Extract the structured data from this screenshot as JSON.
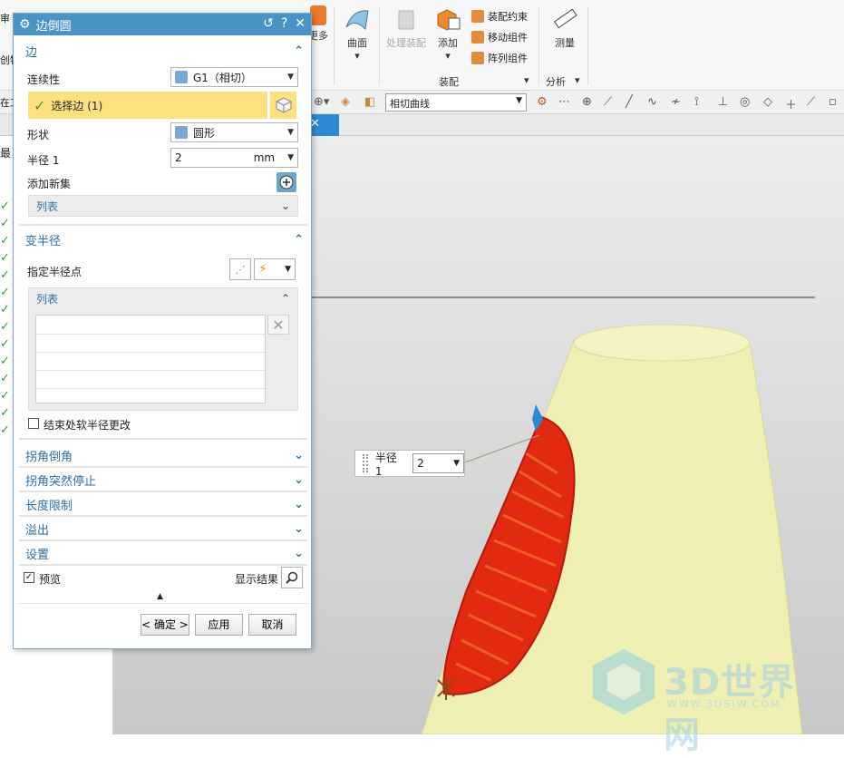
{
  "ribbon": {
    "left_labels": [
      "审",
      "创特"
    ],
    "more_label": "更多",
    "surface": {
      "label": "曲面"
    },
    "assembly_process": {
      "label": "处理装配"
    },
    "add": {
      "label": "添加"
    },
    "assembly_constraint": "装配约束",
    "move_component": "移动组件",
    "array_component": "阵列组件",
    "assembly_group": "装配",
    "measure": {
      "label": "测量"
    },
    "analysis_group": "分析"
  },
  "toolbar2": {
    "left_text": "在工",
    "curve_rule": "相切曲线"
  },
  "tab": {
    "close": "✕"
  },
  "left_nav": {
    "row_label": "最"
  },
  "dialog": {
    "title": "边倒圆",
    "title_buttons": {
      "reset": "↺",
      "help": "?",
      "close": "✕"
    },
    "edge_section": {
      "title": "边",
      "continuity_label": "连续性",
      "continuity_value": "G1（相切）",
      "select_edge": "选择边 (1)",
      "shape_label": "形状",
      "shape_value": "圆形",
      "radius_label": "半径 1",
      "radius_value": "2",
      "radius_unit": "mm",
      "add_new_set": "添加新集",
      "list_label": "列表"
    },
    "variable_radius": {
      "title": "变半径",
      "specify_point": "指定半径点",
      "list_label": "列表",
      "soft_change": "结束处软半径更改",
      "soft_change_checked": false
    },
    "collapsed_sections": [
      "拐角倒角",
      "拐角突然停止",
      "长度限制",
      "溢出",
      "设置"
    ],
    "preview": {
      "label": "预览",
      "checked": true,
      "show_result": "显示结果"
    },
    "buttons": {
      "ok": "< 确定 >",
      "apply": "应用",
      "cancel": "取消"
    }
  },
  "viewport": {
    "callout_label": "半径 1",
    "callout_value": "2",
    "watermark_big": "3D世界网",
    "watermark_small": "WWW.3DSJW.COM",
    "colors": {
      "body": "#efefb4",
      "fillet": "#e22a10",
      "background": "#d6d6d6"
    }
  }
}
